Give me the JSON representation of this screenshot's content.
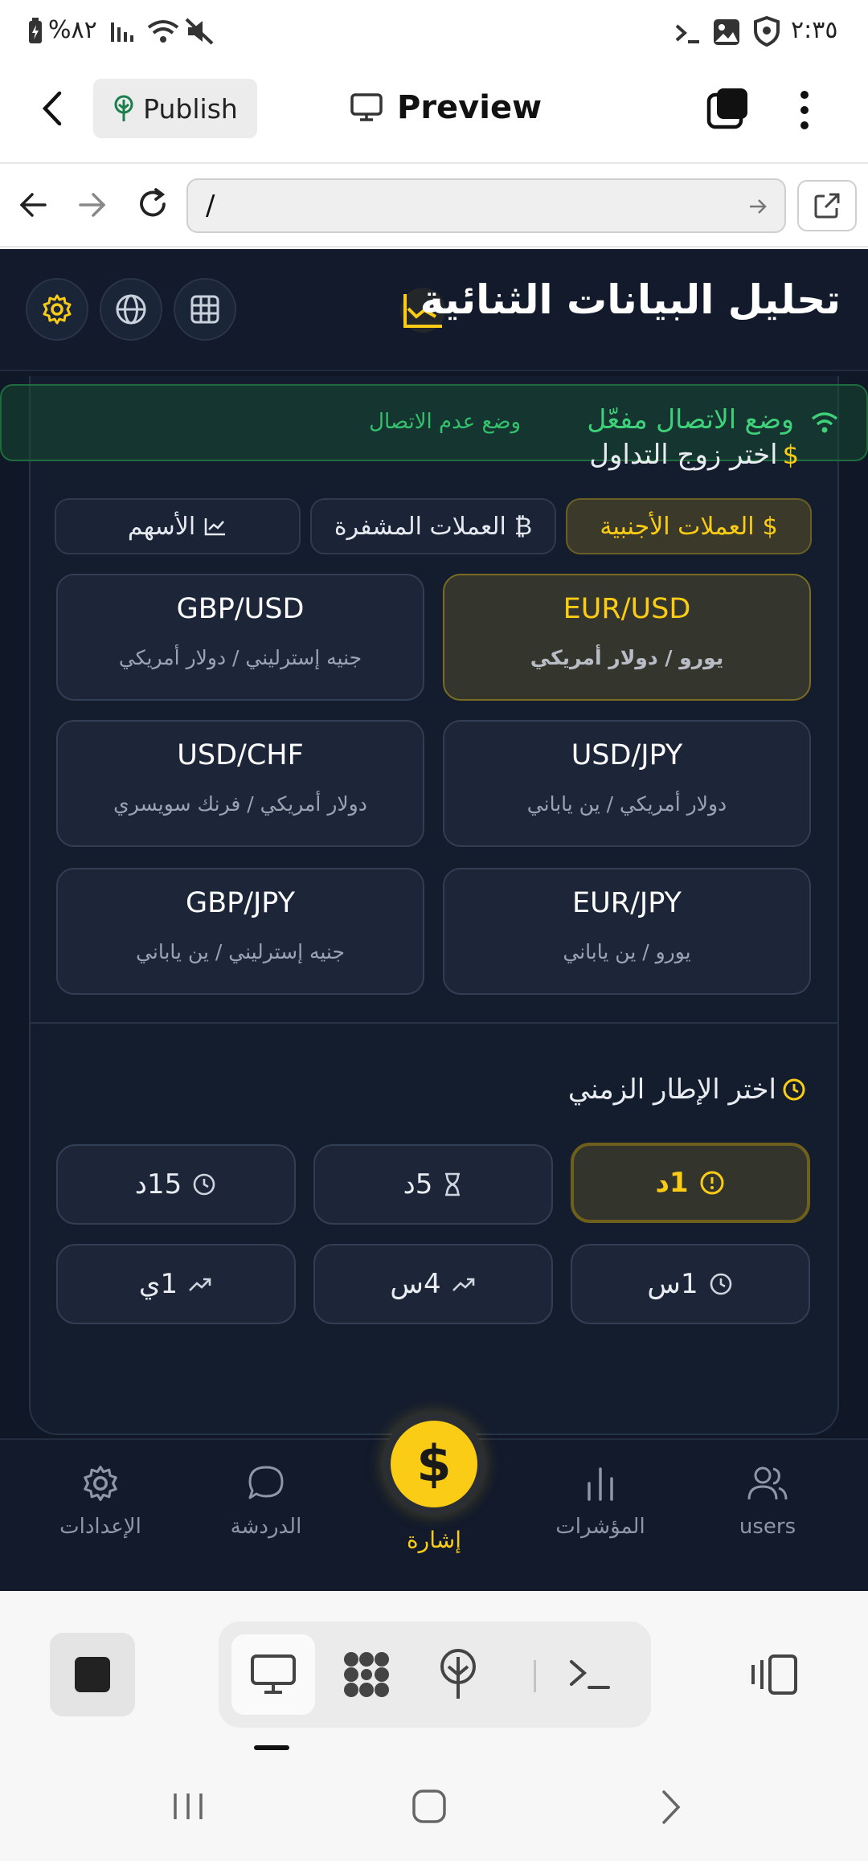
{
  "status_bar": {
    "battery": "%٨٢",
    "time": "٢:٣٥"
  },
  "editor_bar": {
    "publish_label": "Publish",
    "preview_label": "Preview"
  },
  "url_bar": {
    "url": "/"
  },
  "app": {
    "title": "تحليل البيانات الثنائية",
    "connection": {
      "status": "وضع الاتصال مفعّل",
      "mode_link": "وضع عدم الاتصال"
    },
    "pair_section_title": "اختر زوج التداول",
    "categories": [
      {
        "label": "العملات الأجنبية",
        "icon": "dollar-icon",
        "active": true
      },
      {
        "label": "العملات المشفرة",
        "icon": "bitcoin-icon",
        "active": false
      },
      {
        "label": "الأسهم",
        "icon": "chart-line-icon",
        "active": false
      }
    ],
    "pairs": [
      {
        "symbol": "EUR/USD",
        "name": "يورو / دولار أمريكي",
        "active": true
      },
      {
        "symbol": "GBP/USD",
        "name": "جنيه إسترليني / دولار أمريكي",
        "active": false
      },
      {
        "symbol": "USD/JPY",
        "name": "دولار أمريكي / ين ياباني",
        "active": false
      },
      {
        "symbol": "USD/CHF",
        "name": "دولار أمريكي / فرنك سويسري",
        "active": false
      },
      {
        "symbol": "EUR/JPY",
        "name": "يورو / ين ياباني",
        "active": false
      },
      {
        "symbol": "GBP/JPY",
        "name": "جنيه إسترليني / ين ياباني",
        "active": false
      }
    ],
    "timeframe_section_title": "اختر الإطار الزمني",
    "timeframes": [
      {
        "label": "1د",
        "icon": "alert-circle-icon",
        "active": true
      },
      {
        "label": "5د",
        "icon": "hourglass-icon",
        "active": false
      },
      {
        "label": "15د",
        "icon": "clock-icon",
        "active": false
      },
      {
        "label": "1س",
        "icon": "clock-icon",
        "active": false
      },
      {
        "label": "4س",
        "icon": "trending-up-icon",
        "active": false
      },
      {
        "label": "1ي",
        "icon": "trending-up-icon",
        "active": false
      }
    ]
  },
  "bottom_nav": {
    "items": [
      {
        "label": "users",
        "icon": "users-icon"
      },
      {
        "label": "المؤشرات",
        "icon": "bar-chart-icon"
      },
      {
        "label": "إشارة",
        "icon": "dollar-icon",
        "active": true
      },
      {
        "label": "الدردشة",
        "icon": "chat-bubble-icon"
      },
      {
        "label": "الإعدادات",
        "icon": "gear-icon"
      }
    ]
  },
  "colors": {
    "accent": "#facc15",
    "app_bg": "#101727",
    "connected_green": "#3fd07a"
  }
}
